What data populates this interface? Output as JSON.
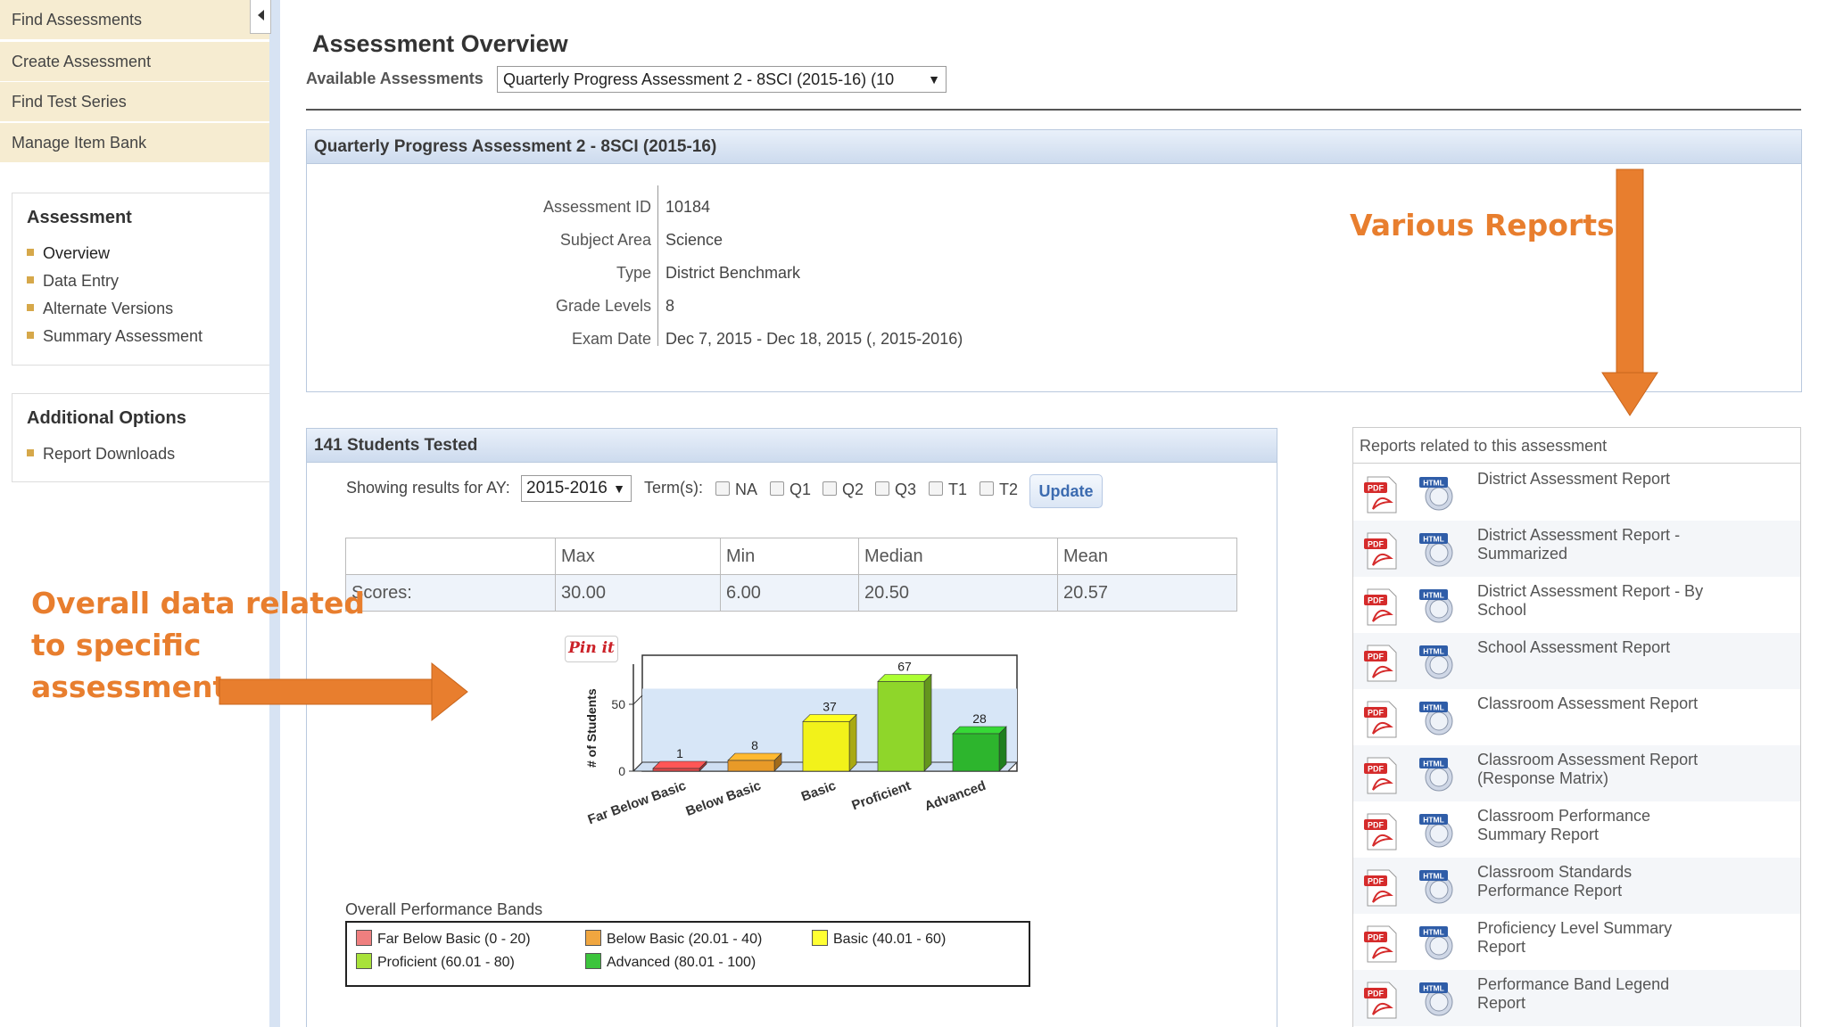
{
  "sidebar": {
    "links": [
      "Find Assessments",
      "Create Assessment",
      "Find Test Series",
      "Manage Item Bank"
    ],
    "assessment_section": {
      "title": "Assessment",
      "items": [
        "Overview",
        "Data Entry",
        "Alternate Versions",
        "Summary Assessment"
      ]
    },
    "options_section": {
      "title": "Additional Options",
      "items": [
        "Report Downloads"
      ]
    }
  },
  "header": {
    "title": "Assessment Overview",
    "available_label": "Available Assessments",
    "selected_assessment": "Quarterly Progress Assessment 2 - 8SCI (2015-16) (10"
  },
  "details": {
    "panel_title": "Quarterly Progress Assessment 2 - 8SCI (2015-16)",
    "fields": [
      {
        "label": "Assessment ID",
        "value": "10184"
      },
      {
        "label": "Subject Area",
        "value": "Science"
      },
      {
        "label": "Type",
        "value": "District Benchmark"
      },
      {
        "label": "Grade Levels",
        "value": "8"
      },
      {
        "label": "Exam Date",
        "value": "Dec 7, 2015 - Dec 18, 2015 (, 2015-2016)"
      }
    ]
  },
  "results": {
    "panel_title": "141 Students Tested",
    "ay_label": "Showing results for AY:",
    "ay_value": "2015-2016",
    "terms_label": "Term(s):",
    "terms": [
      "NA",
      "Q1",
      "Q2",
      "Q3",
      "T1",
      "T2"
    ],
    "update_label": "Update",
    "score_columns": [
      "Max",
      "Min",
      "Median",
      "Mean"
    ],
    "scores_label": "Scores:",
    "scores": [
      "30.00",
      "6.00",
      "20.50",
      "20.57"
    ],
    "pin_label": "Pin it",
    "bands_title": "Overall Performance Bands",
    "bands": [
      {
        "label": "Far Below Basic (0 - 20)",
        "color": "#ef7f7f"
      },
      {
        "label": "Below Basic (20.01 - 40)",
        "color": "#f0a640"
      },
      {
        "label": "Basic (40.01 - 60)",
        "color": "#ffff33"
      },
      {
        "label": "Proficient (60.01 - 80)",
        "color": "#a8e23a"
      },
      {
        "label": "Advanced (80.01 - 100)",
        "color": "#3cc43c"
      }
    ]
  },
  "chart_data": {
    "type": "bar",
    "categories": [
      "Far Below Basic",
      "Below Basic",
      "Basic",
      "Proficient",
      "Advanced"
    ],
    "values": [
      1,
      8,
      37,
      67,
      28
    ],
    "colors": [
      "#e04848",
      "#e89a28",
      "#f2f21a",
      "#8fd62a",
      "#2db52d"
    ],
    "ylabel": "# of Students",
    "yticks": [
      0,
      50
    ],
    "ylim": [
      0,
      100
    ],
    "grid": false,
    "style": "3d"
  },
  "reports": {
    "header": "Reports related to this assessment",
    "items": [
      "District Assessment Report",
      "District Assessment Report - Summarized",
      "District Assessment Report - By School",
      "School Assessment Report",
      "Classroom Assessment Report",
      "Classroom Assessment Report (Response Matrix)",
      "Classroom Performance Summary Report",
      "Classroom Standards Performance Report",
      "Proficiency Level Summary Report",
      "Performance Band Legend Report"
    ]
  },
  "annotations": {
    "various_reports": "Various Reports",
    "overall_data_lines": [
      "Overall data related",
      "to specific",
      "assessment"
    ],
    "accent_color": "#e87e2e"
  }
}
